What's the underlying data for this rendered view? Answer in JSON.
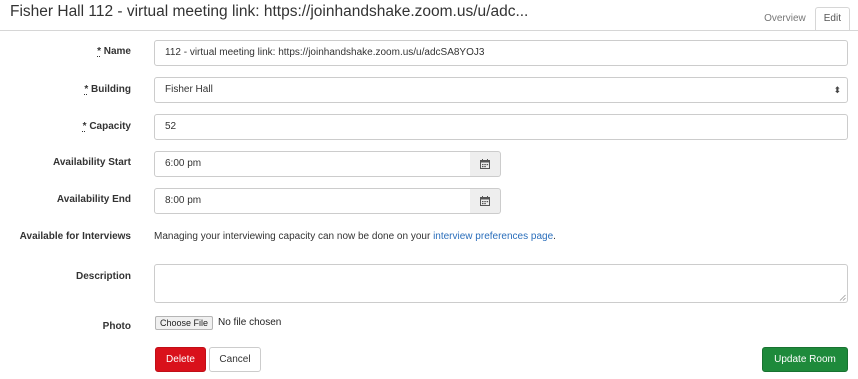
{
  "header": {
    "title": "Fisher Hall 112 - virtual meeting link: https://joinhandshake.zoom.us/u/adc...",
    "tabs": [
      {
        "label": "Overview",
        "active": false
      },
      {
        "label": "Edit",
        "active": true
      }
    ]
  },
  "form": {
    "required_marker": "*",
    "name": {
      "label": "Name",
      "value": "112 - virtual meeting link: https://joinhandshake.zoom.us/u/adcSA8YOJ3"
    },
    "building": {
      "label": "Building",
      "value": "Fisher Hall"
    },
    "capacity": {
      "label": "Capacity",
      "value": "52"
    },
    "availability_start": {
      "label": "Availability Start",
      "value": "6:00 pm",
      "icon": "calendar-icon"
    },
    "availability_end": {
      "label": "Availability End",
      "value": "8:00 pm",
      "icon": "calendar-icon"
    },
    "interviews": {
      "label": "Available for Interviews",
      "text": "Managing your interviewing capacity can now be done on your",
      "link_text": "interview preferences page",
      "suffix": "."
    },
    "description": {
      "label": "Description",
      "value": ""
    },
    "photo": {
      "label": "Photo",
      "button_label": "Choose File",
      "status": "No file chosen"
    }
  },
  "actions": {
    "delete_label": "Delete",
    "cancel_label": "Cancel",
    "update_label": "Update Room"
  },
  "colors": {
    "delete": "#d9111b",
    "update": "#1e8a3b",
    "link": "#2a6ebb"
  }
}
